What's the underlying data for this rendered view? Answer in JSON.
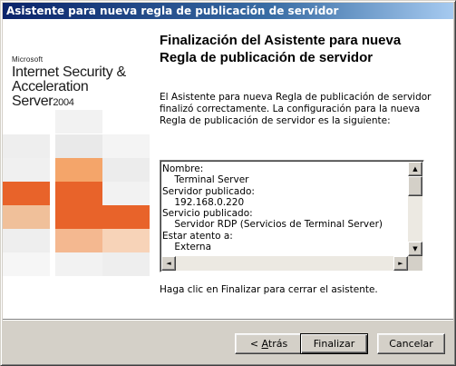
{
  "window": {
    "title": "Asistente para nueva regla de publicación de servidor"
  },
  "brand": {
    "company": "Microsoft",
    "product_line1": "Internet Security &",
    "product_line2": "Acceleration Server",
    "year": "2004"
  },
  "main": {
    "heading": "Finalización del Asistente para nueva Regla de publicación de servidor",
    "intro": "El Asistente para nueva Regla de publicación de servidor finalizó correctamente. La configuración para la nueva Regla de publicación de servidor es la siguiente:",
    "summary_lines": [
      "Nombre:",
      "    Terminal Server",
      "Servidor publicado:",
      "    192.168.0.220",
      "Servicio publicado:",
      "    Servidor RDP (Servicios de Terminal Server)",
      "Estar atento a:",
      "    Externa"
    ],
    "finish_hint": "Haga clic en Finalizar para cerrar el asistente."
  },
  "buttons": {
    "back_prefix": "< ",
    "back_accel": "A",
    "back_rest": "trás",
    "finish": "Finalizar",
    "cancel": "Cancelar"
  },
  "icons": {
    "scroll_up": "▲",
    "scroll_down": "▼",
    "scroll_left": "◄",
    "scroll_right": "►"
  },
  "colors": {
    "title_bar_start": "#0a246a",
    "brand_orange": "#e8632a",
    "light_orange": "#f4a56a",
    "tile_gray": "#e6e6e6"
  }
}
